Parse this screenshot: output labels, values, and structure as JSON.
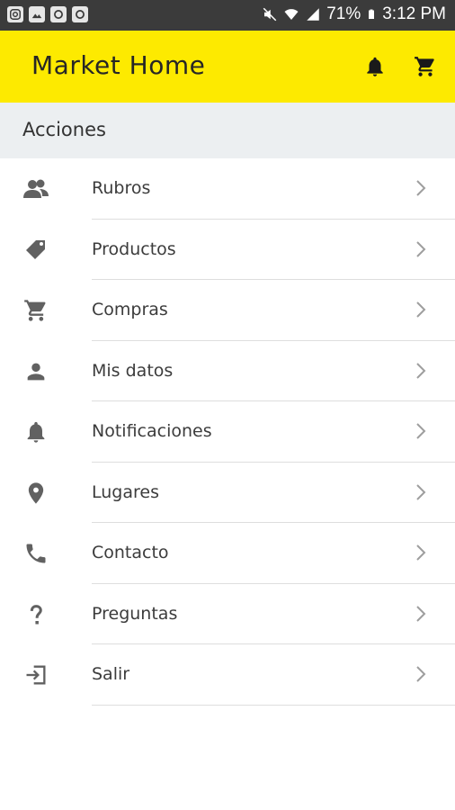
{
  "status_bar": {
    "battery": "71%",
    "time": "3:12 PM",
    "left_icons": [
      "instagram-icon",
      "gallery-icon",
      "app-icon",
      "app-icon"
    ],
    "right_icons": [
      "mute-icon",
      "wifi-icon",
      "signal-icon",
      "battery-icon"
    ]
  },
  "app_bar": {
    "title": "Market Home",
    "background": "#fdea00",
    "actions": [
      "bell-icon",
      "cart-icon"
    ]
  },
  "section": {
    "title": "Acciones"
  },
  "menu": {
    "items": [
      {
        "label": "Rubros",
        "icon": "groups-icon"
      },
      {
        "label": "Productos",
        "icon": "tag-icon"
      },
      {
        "label": "Compras",
        "icon": "cart-icon"
      },
      {
        "label": "Mis datos",
        "icon": "person-icon"
      },
      {
        "label": "Notificaciones",
        "icon": "bell-icon"
      },
      {
        "label": "Lugares",
        "icon": "location-pin-icon"
      },
      {
        "label": "Contacto",
        "icon": "phone-icon"
      },
      {
        "label": "Preguntas",
        "icon": "question-icon"
      },
      {
        "label": "Salir",
        "icon": "exit-icon"
      }
    ]
  }
}
